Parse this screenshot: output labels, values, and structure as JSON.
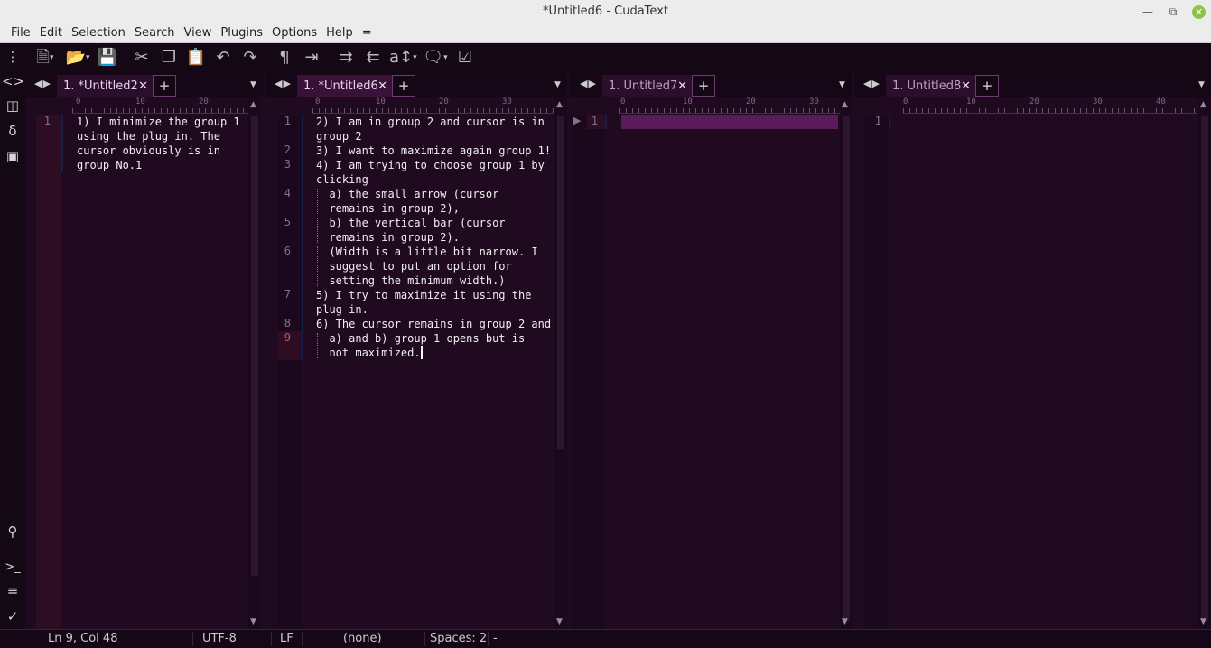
{
  "window": {
    "title": "*Untitled6 - CudaText"
  },
  "menu": [
    "File",
    "Edit",
    "Selection",
    "Search",
    "View",
    "Plugins",
    "Options",
    "Help",
    "="
  ],
  "toolbar": {
    "icons": [
      "new-file-icon",
      "open-file-icon",
      "save-icon",
      "cut-icon",
      "copy-icon",
      "paste-icon",
      "undo-icon",
      "redo-icon",
      "show-unprinted-icon",
      "wrap-icon",
      "indent-icon",
      "unindent-icon",
      "case-icon",
      "comment-icon",
      "check-icon"
    ]
  },
  "sidebar": {
    "top_icons": [
      "menu-dots-icon",
      "code-tree-icon",
      "project-icon",
      "snippets-icon",
      "tabs-icon"
    ],
    "bottom_icons": [
      "search-icon",
      "console-icon",
      "output-icon",
      "validate-icon"
    ]
  },
  "groups": [
    {
      "tab_label": "1. *Untitled2",
      "ruler_ticks": [
        "0",
        "10",
        "20"
      ],
      "lines": [
        {
          "num": "1",
          "segments": [
            "1) I minimize the group 1",
            "using the plug in. The",
            "cursor obviously is in",
            "group No.1"
          ]
        }
      ]
    },
    {
      "tab_label": "1. *Untitled6",
      "ruler_ticks": [
        "0",
        "10",
        "20",
        "30"
      ],
      "lines": [
        {
          "num": "1",
          "segments": [
            "2) I am in group 2 and cursor is in",
            "group 2"
          ]
        },
        {
          "num": "2",
          "segments": [
            "3) I want to maximize again group 1!"
          ]
        },
        {
          "num": "3",
          "segments": [
            "4) I am trying to choose group 1 by",
            "clicking"
          ]
        },
        {
          "num": "4",
          "segments": [
            "  a) the small arrow (cursor",
            "  remains in group 2),"
          ]
        },
        {
          "num": "5",
          "segments": [
            "  b) the vertical bar (cursor",
            "  remains in group 2)."
          ]
        },
        {
          "num": "6",
          "segments": [
            "  (Width is a little bit narrow. I",
            "  suggest to put an option for",
            "  setting the minimum width.)"
          ]
        },
        {
          "num": "7",
          "segments": [
            "5) I try to maximize it using the",
            "plug in."
          ]
        },
        {
          "num": "8",
          "segments": [
            "6) The cursor remains in group 2 and"
          ]
        },
        {
          "num": "9",
          "segments": [
            "  a) and b) group 1 opens but is",
            "  not maximized."
          ]
        }
      ]
    },
    {
      "tab_label": "1. Untitled7",
      "ruler_ticks": [
        "0",
        "10",
        "20",
        "30"
      ],
      "lines": [
        {
          "num": "1",
          "segments": [
            ""
          ]
        }
      ]
    },
    {
      "tab_label": "1. Untitled8",
      "ruler_ticks": [
        "0",
        "10",
        "20",
        "30",
        "40"
      ],
      "lines": [
        {
          "num": "1",
          "segments": [
            ""
          ]
        }
      ]
    }
  ],
  "status": {
    "position": "Ln 9, Col 48",
    "encoding": "UTF-8",
    "line_ending": "LF",
    "lexer": "(none)",
    "indent": "Spaces: 2",
    "extra": "-"
  }
}
